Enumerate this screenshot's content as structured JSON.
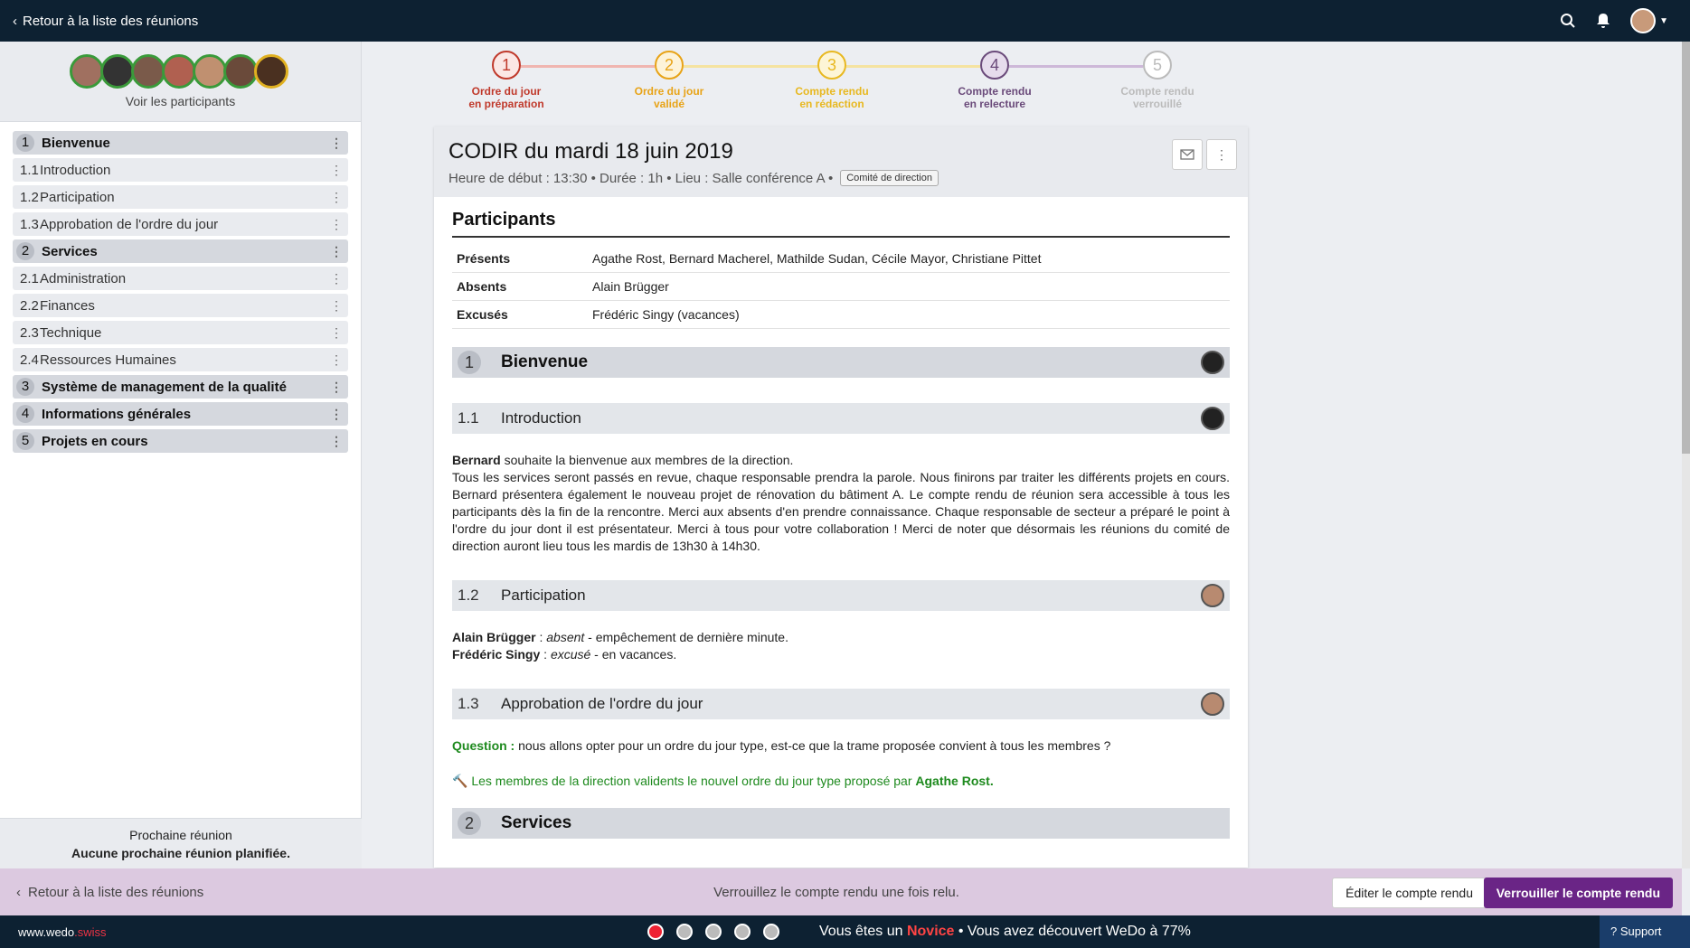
{
  "topbar": {
    "back_label": "Retour à la liste des réunions"
  },
  "sidebar": {
    "participants_label": "Voir les participants",
    "avatar_count": 7,
    "agenda": [
      {
        "num": "1",
        "label": "Bienvenue",
        "main": true
      },
      {
        "num": "1.1",
        "label": "Introduction",
        "main": false
      },
      {
        "num": "1.2",
        "label": "Participation",
        "main": false
      },
      {
        "num": "1.3",
        "label": "Approbation de l'ordre du jour",
        "main": false
      },
      {
        "num": "2",
        "label": "Services",
        "main": true
      },
      {
        "num": "2.1",
        "label": "Administration",
        "main": false
      },
      {
        "num": "2.2",
        "label": "Finances",
        "main": false
      },
      {
        "num": "2.3",
        "label": "Technique",
        "main": false
      },
      {
        "num": "2.4",
        "label": "Ressources Humaines",
        "main": false
      },
      {
        "num": "3",
        "label": "Système de management de la qualité",
        "main": true
      },
      {
        "num": "4",
        "label": "Informations générales",
        "main": true
      },
      {
        "num": "5",
        "label": "Projets en cours",
        "main": true
      }
    ],
    "next_meeting_title": "Prochaine réunion",
    "next_meeting_value": "Aucune prochaine réunion planifiée."
  },
  "steps": [
    {
      "num": "1",
      "l1": "Ordre du jour",
      "l2": "en préparation",
      "color": "#c0392b",
      "bg": "#fbe7e5"
    },
    {
      "num": "2",
      "l1": "Ordre du jour",
      "l2": "validé",
      "color": "#e8a317",
      "bg": "#fdf3d9"
    },
    {
      "num": "3",
      "l1": "Compte rendu",
      "l2": "en rédaction",
      "color": "#e8b820",
      "bg": "#fdf5d6"
    },
    {
      "num": "4",
      "l1": "Compte rendu",
      "l2": "en relecture",
      "color": "#6a4a7a",
      "bg": "#e6dcec"
    },
    {
      "num": "5",
      "l1": "Compte rendu",
      "l2": "verrouillé",
      "color": "#bbbbbb",
      "bg": "#ffffff"
    }
  ],
  "meeting": {
    "title": "CODIR du mardi 18 juin 2019",
    "meta": "Heure de début : 13:30 • Durée : 1h • Lieu : Salle conférence A  •",
    "tag": "Comité de direction"
  },
  "participants": {
    "heading": "Participants",
    "rows": [
      {
        "k": "Présents",
        "v": "Agathe Rost, Bernard Macherel, Mathilde Sudan, Cécile Mayor, Christiane Pittet"
      },
      {
        "k": "Absents",
        "v": "Alain Brügger"
      },
      {
        "k": "Excusés",
        "v": "Frédéric Singy (vacances)"
      }
    ]
  },
  "content": {
    "s1": {
      "num": "1",
      "title": "Bienvenue"
    },
    "s11": {
      "num": "1.1",
      "title": "Introduction"
    },
    "intro_name": "Bernard",
    "intro_line1": " souhaite la bienvenue aux membres de la direction.",
    "intro_rest": "Tous les services seront passés en revue, chaque responsable prendra la parole. Nous finirons par traiter les différents projets en cours. Bernard présentera également le nouveau projet de rénovation du bâtiment A. Le compte rendu de réunion sera accessible à tous les participants dès la fin de la rencontre. Merci aux absents d'en prendre connaissance. Chaque responsable de secteur a préparé le point à l'ordre du jour dont il est présentateur. Merci à tous pour votre collaboration ! Merci de noter que désormais les réunions du comité de direction auront lieu tous les mardis de 13h30 à 14h30.",
    "s12": {
      "num": "1.2",
      "title": "Participation"
    },
    "p1_name": "Alain Brügger",
    "p1_sep": " : ",
    "p1_status": "absent",
    "p1_rest": " - empêchement de dernière minute.",
    "p2_name": "Frédéric Singy",
    "p2_sep": " : ",
    "p2_status": "excusé",
    "p2_rest": " - en vacances.",
    "s13": {
      "num": "1.3",
      "title": "Approbation de l'ordre du jour"
    },
    "q_label": "Question :",
    "q_text": " nous allons opter pour un ordre du jour type, est-ce que la trame proposée convient à tous les membres ?",
    "decision_text": "Les membres de la direction validents le nouvel ordre du jour type proposé par ",
    "decision_name": "Agathe Rost.",
    "s2": {
      "num": "2",
      "title": "Services"
    }
  },
  "actionbar": {
    "back_label": "Retour à la liste des réunions",
    "message": "Verrouillez le compte rendu une fois relu.",
    "edit_label": "Éditer le compte rendu",
    "lock_label": "Verrouiller le compte rendu"
  },
  "footer": {
    "logo_main": "www.wedo",
    "logo_accent": ".swiss",
    "status_pre": "Vous êtes un ",
    "status_level": "Novice",
    "status_post": " • Vous avez découvert WeDo à 77%",
    "support_label": "Support"
  }
}
